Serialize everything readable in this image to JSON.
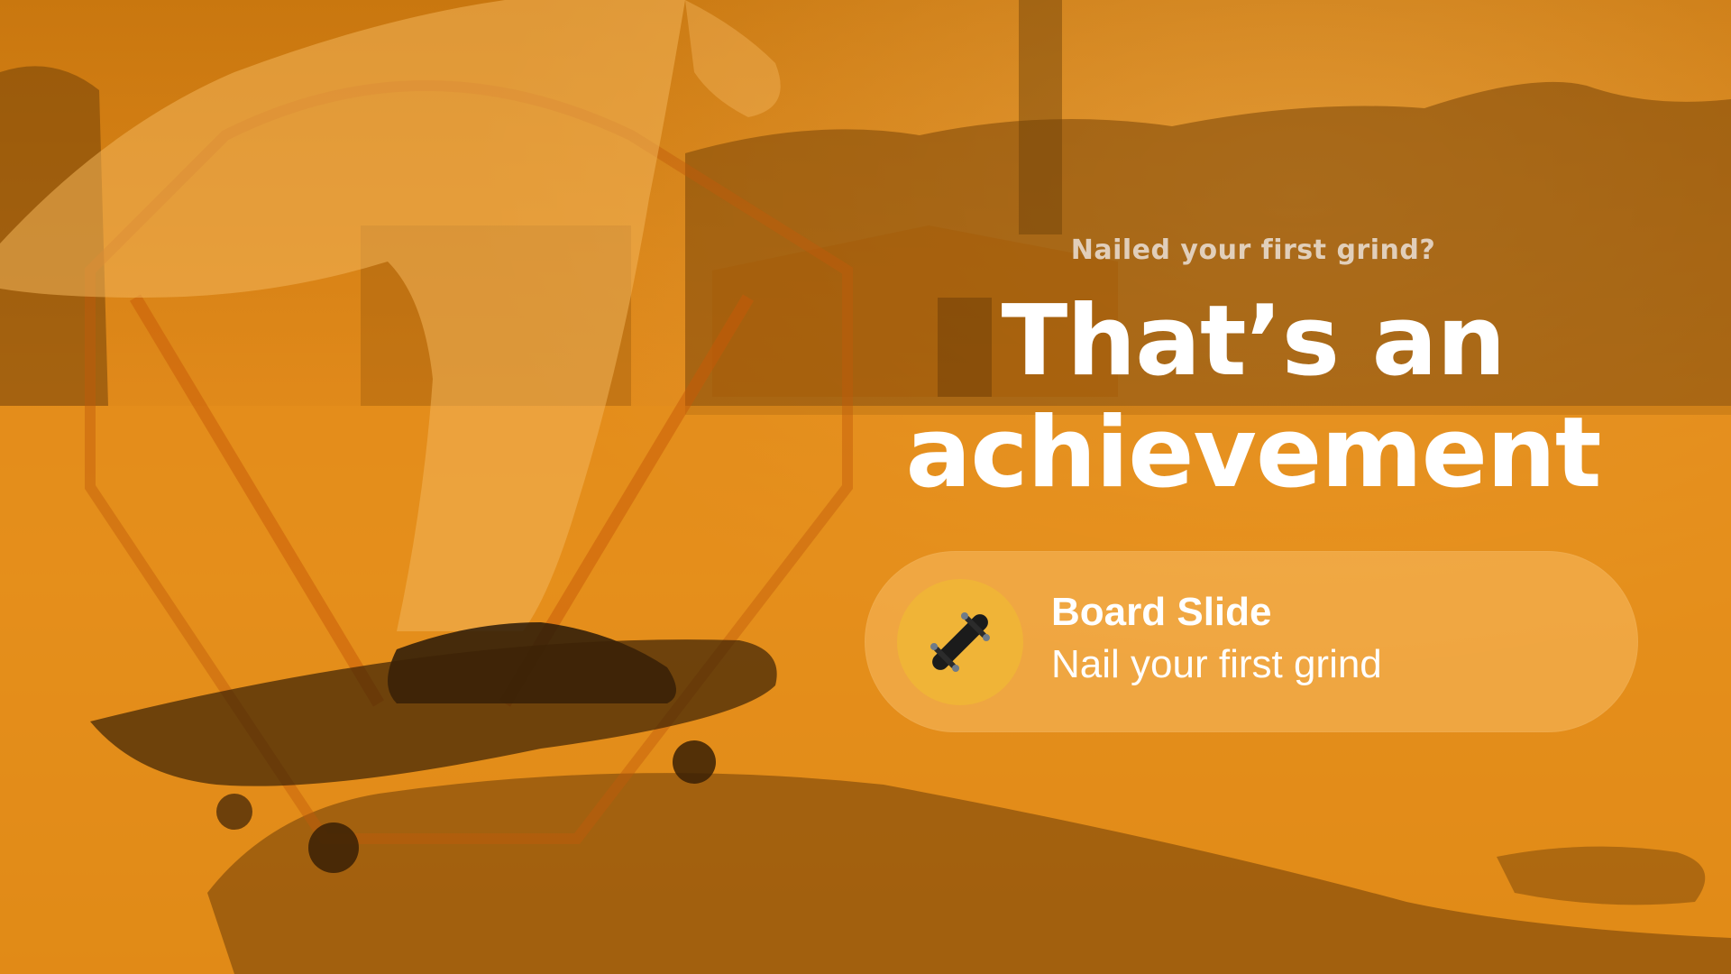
{
  "promo": {
    "kicker": "Nailed your first grind?",
    "headline": "That’s an achievement"
  },
  "achievement": {
    "title": "Board Slide",
    "description": "Nail your first grind",
    "icon": "skateboard-icon",
    "badge_color": "#f0b437"
  },
  "theme": {
    "overlay_color": "#e08a18",
    "text_color": "#ffffff"
  }
}
